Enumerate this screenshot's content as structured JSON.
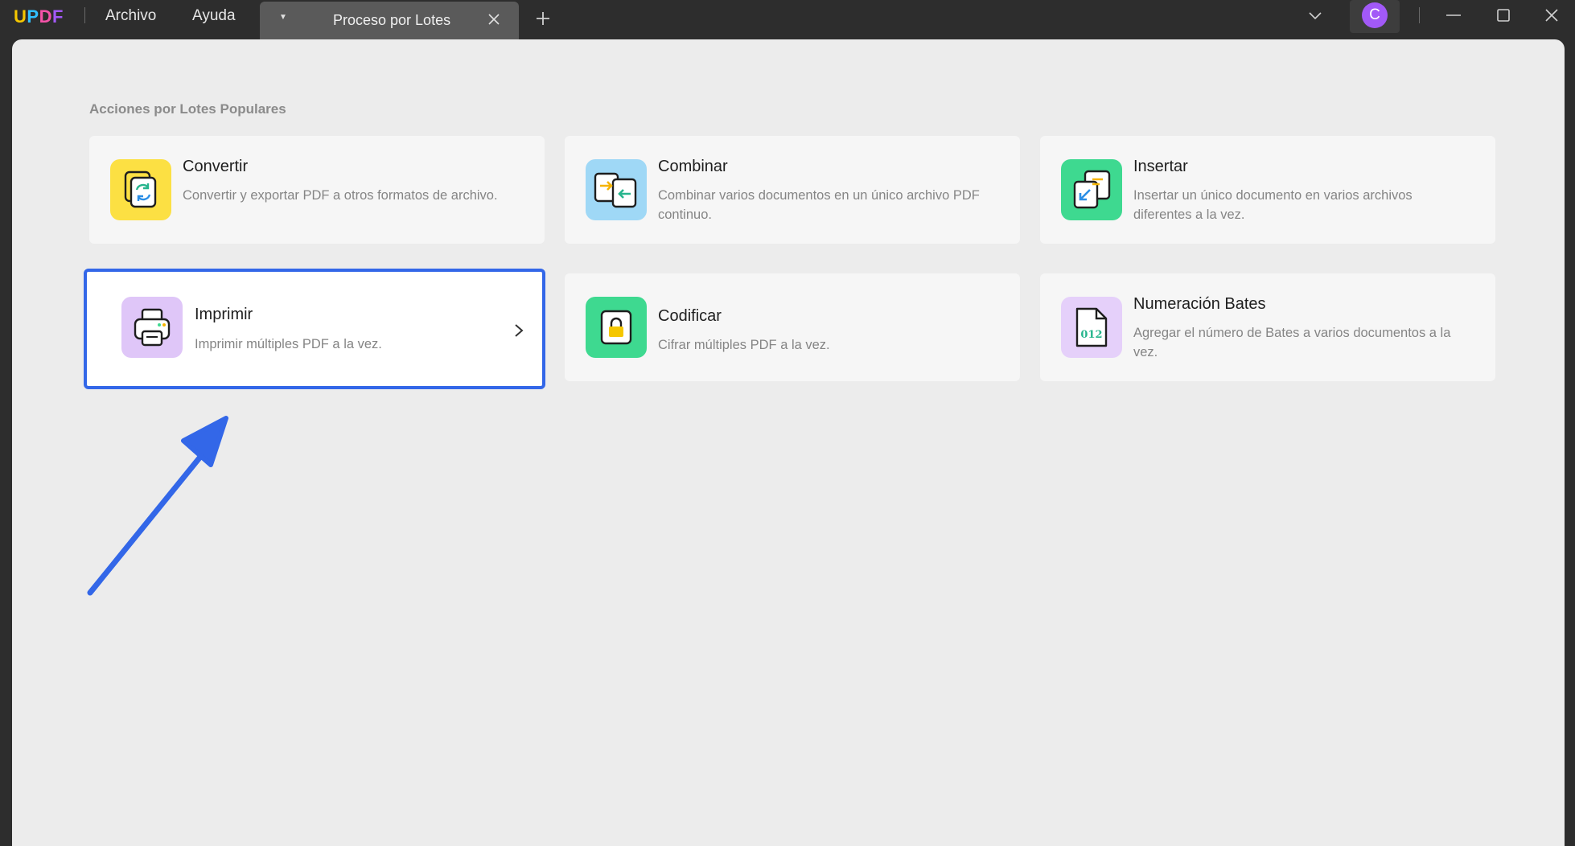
{
  "app": {
    "logo_letters": [
      "U",
      "P",
      "D",
      "F"
    ],
    "logo_colors": [
      "#f5c700",
      "#30c0ff",
      "#f553a8",
      "#a259f7"
    ]
  },
  "menu": {
    "file": "Archivo",
    "help": "Ayuda"
  },
  "tab": {
    "title": "Proceso por Lotes"
  },
  "user": {
    "avatar_letter": "C",
    "avatar_color": "#a259f7"
  },
  "section": {
    "title": "Acciones por Lotes Populares"
  },
  "cards": [
    {
      "title": "Convertir",
      "desc": "Convertir y exportar PDF a otros formatos de archivo.",
      "icon": "convert-icon",
      "icon_bg": "#fce043"
    },
    {
      "title": "Combinar",
      "desc": "Combinar varios documentos en un único archivo PDF continuo.",
      "icon": "combine-icon",
      "icon_bg": "#9fd8f6"
    },
    {
      "title": "Insertar",
      "desc": "Insertar un único documento en varios archivos diferentes a la vez.",
      "icon": "insert-icon",
      "icon_bg": "#3ed990"
    },
    {
      "title": "Imprimir",
      "desc": "Imprimir múltiples PDF a la vez.",
      "icon": "printer-icon",
      "icon_bg": "#dfc6f8",
      "selected": true
    },
    {
      "title": "Codificar",
      "desc": "Cifrar múltiples PDF a la vez.",
      "icon": "lock-icon",
      "icon_bg": "#3ed990"
    },
    {
      "title": "Numeración Bates",
      "desc": "Agregar el número de Bates a varios documentos a la vez.",
      "icon": "bates-number-icon",
      "icon_bg": "#e5d0fa"
    }
  ],
  "bates_icon_text": "012",
  "colors": {
    "selection_border": "#3367e8",
    "annotation_arrow": "#3367e8"
  }
}
